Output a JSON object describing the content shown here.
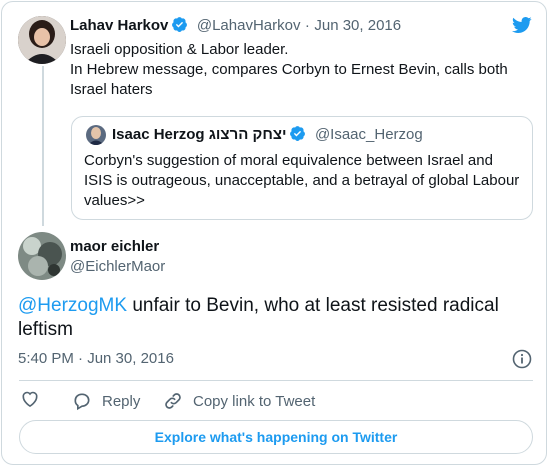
{
  "parent": {
    "name": "Lahav Harkov",
    "handle": "@LahavHarkov",
    "sep": "·",
    "date": "Jun 30, 2016",
    "lines": [
      "Israeli opposition & Labor leader.",
      "In Hebrew message, compares Corbyn to Ernest Bevin, calls both",
      "Israel haters"
    ]
  },
  "quote": {
    "name": "Isaac Herzog יצחק הרצוג",
    "handle": "@Isaac_Herzog",
    "lines": [
      "Corbyn's suggestion of moral equivalence between Israel and",
      "ISIS is outrageous, unacceptable, and a betrayal of global Labour",
      "values>>"
    ]
  },
  "reply": {
    "name": "maor eichler",
    "handle": "@EichlerMaor",
    "mention": "@HerzogMK",
    "text_rest_line1": " unfair to Bevin, who at least resisted radical",
    "text_line2": "leftism",
    "time": "5:40 PM · Jun 30, 2016"
  },
  "actions": {
    "reply_label": "Reply",
    "copy_label": "Copy link to Tweet"
  },
  "cta_label": "Explore what's happening on Twitter",
  "colors": {
    "accent": "#1d9bf0",
    "muted": "#536471",
    "border": "#cfd9de"
  },
  "icons": [
    "twitter-bird-icon",
    "verified-badge-icon",
    "info-icon",
    "heart-icon",
    "reply-bubble-icon",
    "link-icon"
  ]
}
